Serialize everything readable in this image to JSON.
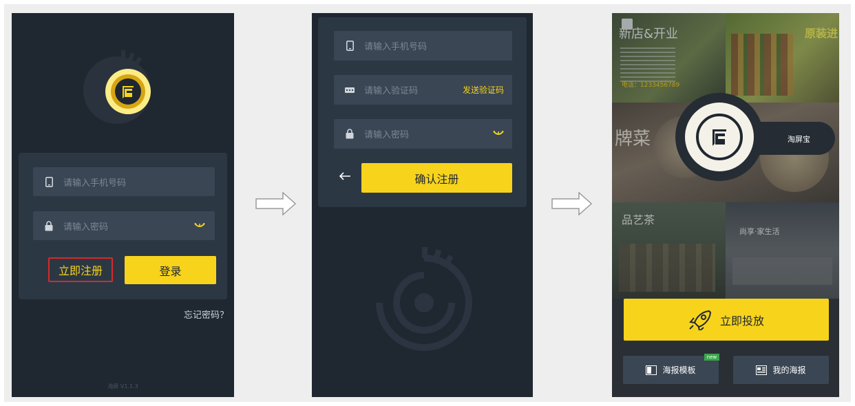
{
  "screen1": {
    "phone_placeholder": "请输入手机号码",
    "password_placeholder": "请输入密码",
    "register_label": "立即注册",
    "login_label": "登录",
    "forgot_label": "忘记密码？",
    "version_label": "海屏 V1.1.3"
  },
  "screen2": {
    "phone_placeholder": "请输入手机号码",
    "code_placeholder": "请输入验证码",
    "send_code_label": "发送验证码",
    "password_placeholder": "请输入密码",
    "confirm_label": "确认注册"
  },
  "screen3": {
    "brand_label": "淘屏宝",
    "publish_label": "立即投放",
    "template_label": "海报模板",
    "new_badge": "new",
    "my_posters_label": "我的海报",
    "poster_texts": {
      "new_store": "新店&开业",
      "original": "原装进",
      "phone": "电话：1233456789",
      "food_title": "牌菜",
      "tea_title": "品艺茶",
      "home_title": "尚享·家生活"
    }
  },
  "colors": {
    "accent": "#f7d31c",
    "bg": "#1f2731",
    "panel": "#2c3744",
    "field": "#3a4654"
  }
}
